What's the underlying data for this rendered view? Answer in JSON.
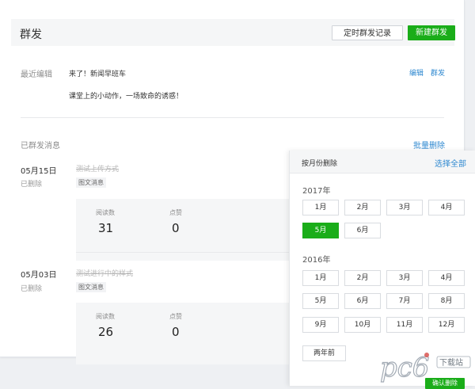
{
  "header": {
    "title": "群发",
    "scheduled_label": "定时群发记录",
    "new_label": "新建群发"
  },
  "recent": {
    "label": "最近编辑",
    "title": "来了！新闻早班车",
    "subtitle": "课堂上的小动作，一场致命的诱惑！",
    "edit_label": "编辑",
    "send_label": "群发"
  },
  "sent": {
    "label": "已群发消息",
    "batch_delete_label": "批量删除",
    "items": [
      {
        "date": "05月15日",
        "status": "已删除",
        "title": "测试上传方式",
        "tag": "图文消息",
        "reads_label": "阅读数",
        "reads": "31",
        "likes_label": "点赞",
        "likes": "0"
      },
      {
        "date": "05月03日",
        "status": "已删除",
        "title": "测试进行中的样式",
        "tag": "图文消息",
        "reads_label": "阅读数",
        "reads": "26",
        "likes_label": "点赞",
        "likes": "0"
      }
    ]
  },
  "panel": {
    "title": "按月份删除",
    "select_all": "选择全部",
    "years": [
      {
        "label": "2017年",
        "months": [
          "1月",
          "2月",
          "3月",
          "4月",
          "5月",
          "6月"
        ],
        "selected": "5月"
      },
      {
        "label": "2016年",
        "months": [
          "1月",
          "2月",
          "3月",
          "4月",
          "5月",
          "6月",
          "7月",
          "8月",
          "9月",
          "10月",
          "11月",
          "12月"
        ]
      }
    ],
    "earlier": "两年前",
    "confirm_label": "确认删除"
  },
  "watermark": {
    "logo_text": "pc6",
    "site_text": "下载站"
  },
  "colors": {
    "accent": "#1aad19",
    "link": "#2e88d0"
  }
}
